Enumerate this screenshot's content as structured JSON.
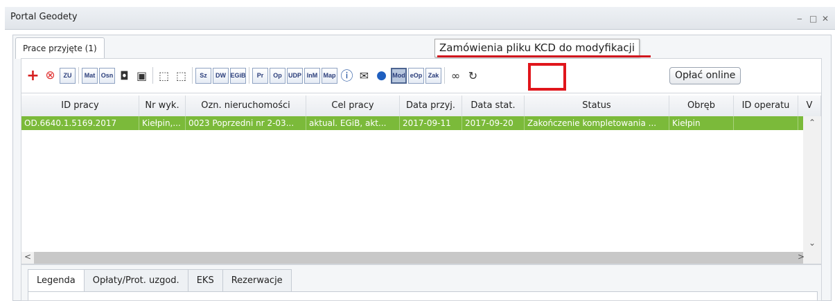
{
  "window": {
    "title": "Portal Geodety"
  },
  "top_tab": {
    "label": "Prace przyjęte (1)"
  },
  "tooltip": {
    "text": "Zamówienia pliku KCD do modyfikacji"
  },
  "toolbar": {
    "buttons": [
      "ZU",
      "Mat",
      "Osn",
      "Sz",
      "DW",
      "EGiB",
      "Pr",
      "Op",
      "UDP",
      "InM",
      "Map",
      "Mod",
      "eOp",
      "Zak"
    ],
    "pay_label": "Opłać online"
  },
  "grid": {
    "columns": [
      "ID pracy",
      "Nr wyk.",
      "Ozn. nieruchomości",
      "Cel pracy",
      "Data przyj.",
      "Data stat.",
      "Status",
      "Obręb",
      "ID operatu",
      "V"
    ],
    "rows": [
      [
        "OD.6640.1.5169.2017",
        "Kiełpin,...",
        "0023 Poprzedni nr 2-03...",
        "aktual. EGiB, akt...",
        "2017-09-11",
        "2017-09-20",
        "Zakończenie kompletowania ...",
        "Kiełpin",
        "",
        ""
      ]
    ]
  },
  "bottom_tabs": [
    "Legenda",
    "Opłaty/Prot. uzgod.",
    "EKS",
    "Rezerwacje"
  ],
  "colors": {
    "row_selected": "#7bba3a",
    "highlight": "#e0151b"
  },
  "icons": {
    "add": "plus-icon",
    "delete": "x-circle-icon",
    "camera_search": "camera-search-icon",
    "camera": "camera-icon",
    "area_select": "area-select-icon",
    "edit": "edit-area-icon",
    "info": "info-icon",
    "mail": "mail-icon",
    "chat": "chat-icon",
    "search": "binoculars-icon",
    "refresh": "refresh-icon"
  }
}
